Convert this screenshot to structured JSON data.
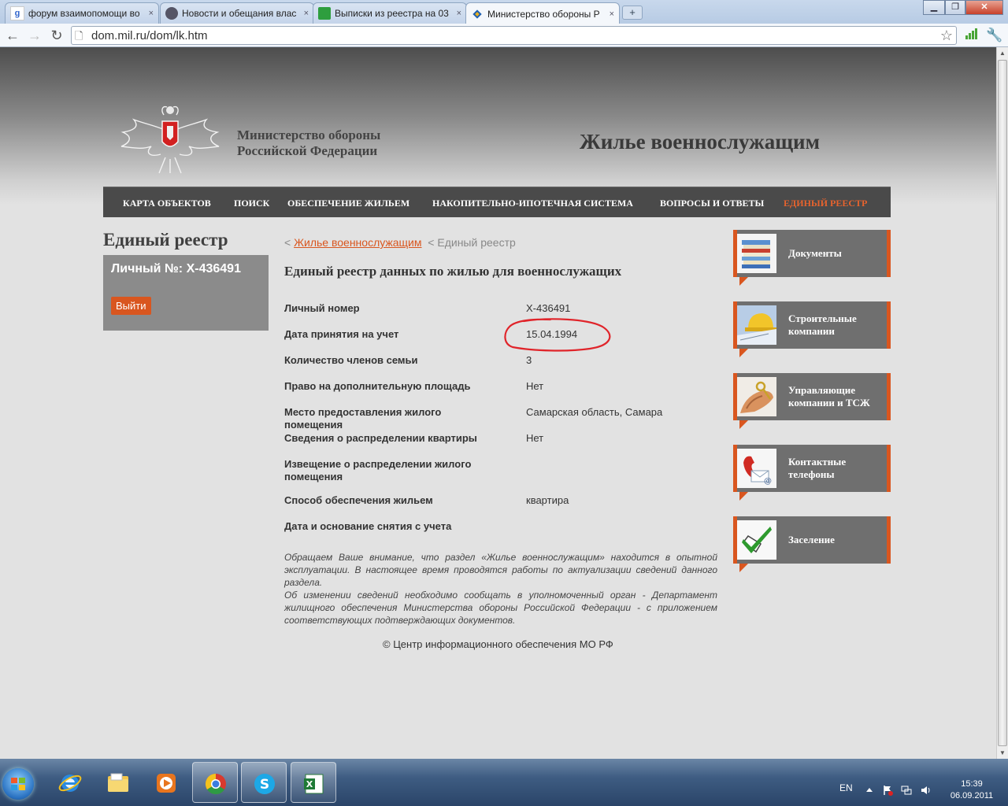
{
  "browser": {
    "tabs": [
      {
        "title": "форум взаимопомощи во",
        "favicon": "google-icon"
      },
      {
        "title": "Новости и обещания влас",
        "favicon": "avatar-icon"
      },
      {
        "title": "Выписки из реестра на 03",
        "favicon": "spreadsheet-icon"
      },
      {
        "title": "Министерство обороны Р",
        "favicon": "ministry-icon",
        "active": true
      }
    ],
    "close_glyph": "×",
    "new_tab_glyph": "+",
    "url": "dom.mil.ru/dom/lk.htm"
  },
  "header": {
    "ministry_line1": "Министерство обороны",
    "ministry_line2": "Российской Федерации",
    "site_title": "Жилье военнослужащим"
  },
  "nav": {
    "items": [
      {
        "label": "КАРТА ОБЪЕКТОВ"
      },
      {
        "label": "ПОИСК"
      },
      {
        "label": "ОБЕСПЕЧЕНИЕ ЖИЛЬЕМ"
      },
      {
        "label": "НАКОПИТЕЛЬНО-ИПОТЕЧНАЯ СИСТЕМА"
      },
      {
        "label": "ВОПРОСЫ И ОТВЕТЫ"
      },
      {
        "label": "ЕДИНЫЙ РЕЕСТР",
        "active": true
      }
    ]
  },
  "left": {
    "title": "Единый реестр",
    "personal_number": "Личный №: Х-436491",
    "logout_label": "Выйти"
  },
  "breadcrumb": {
    "sep": "<",
    "link": "Жилье военнослужащим",
    "current": "Единый реестр"
  },
  "main": {
    "heading": "Единый реестр данных по жилью для военнослужащих",
    "rows": [
      {
        "label": "Личный номер",
        "value": "Х-436491"
      },
      {
        "label": "Дата принятия на учет",
        "value": "15.04.1994"
      },
      {
        "label": "Количество членов семьи",
        "value": "3"
      },
      {
        "label": "Право на дополнительную площадь",
        "value": "Нет"
      },
      {
        "label": "Место предоставления жилого помещения",
        "value": "Самарская область, Самара"
      },
      {
        "label": "Сведения о распределении квартиры",
        "value": "Нет"
      },
      {
        "label": "Извещение о распределении жилого помещения",
        "value": ""
      },
      {
        "label": "Способ обеспечения жильем",
        "value": "квартира"
      },
      {
        "label": "Дата и основание снятия с учета",
        "value": ""
      }
    ],
    "notice_p1": "Обращаем Ваше внимание, что раздел «Жилье военнослужащим» находится в опытной эксплуатации. В настоящее время проводятся работы по актуализации сведений данного раздела.",
    "notice_p2": "Об изменении сведений необходимо сообщать в уполномоченный орган - Департамент жилищного обеспечения Министерства обороны Российской Федерации - с приложением соответствующих подтверждающих документов.",
    "footer": "© Центр информационного обеспечения МО РФ"
  },
  "sidebar": {
    "items": [
      {
        "label": "Документы",
        "icon": "documents-icon"
      },
      {
        "label": "Строительные компании",
        "icon": "construction-icon"
      },
      {
        "label": "Управляющие компании и ТСЖ",
        "icon": "keys-icon"
      },
      {
        "label": "Контактные телефоны",
        "icon": "phone-icon"
      },
      {
        "label": "Заселение",
        "icon": "checkmark-icon"
      }
    ]
  },
  "taskbar": {
    "apps": [
      "internet-explorer-icon",
      "explorer-folder-icon",
      "media-player-icon",
      "chrome-icon",
      "skype-icon",
      "excel-icon"
    ],
    "lang": "EN",
    "time": "15:39",
    "date": "06.09.2011"
  },
  "colors": {
    "accent": "#d9561f",
    "nav_bg": "#4a4a4a",
    "page_bg": "#e2e2e2",
    "sidebar_tile": "#6f6f6f",
    "annotation_circle": "#e0242a"
  }
}
